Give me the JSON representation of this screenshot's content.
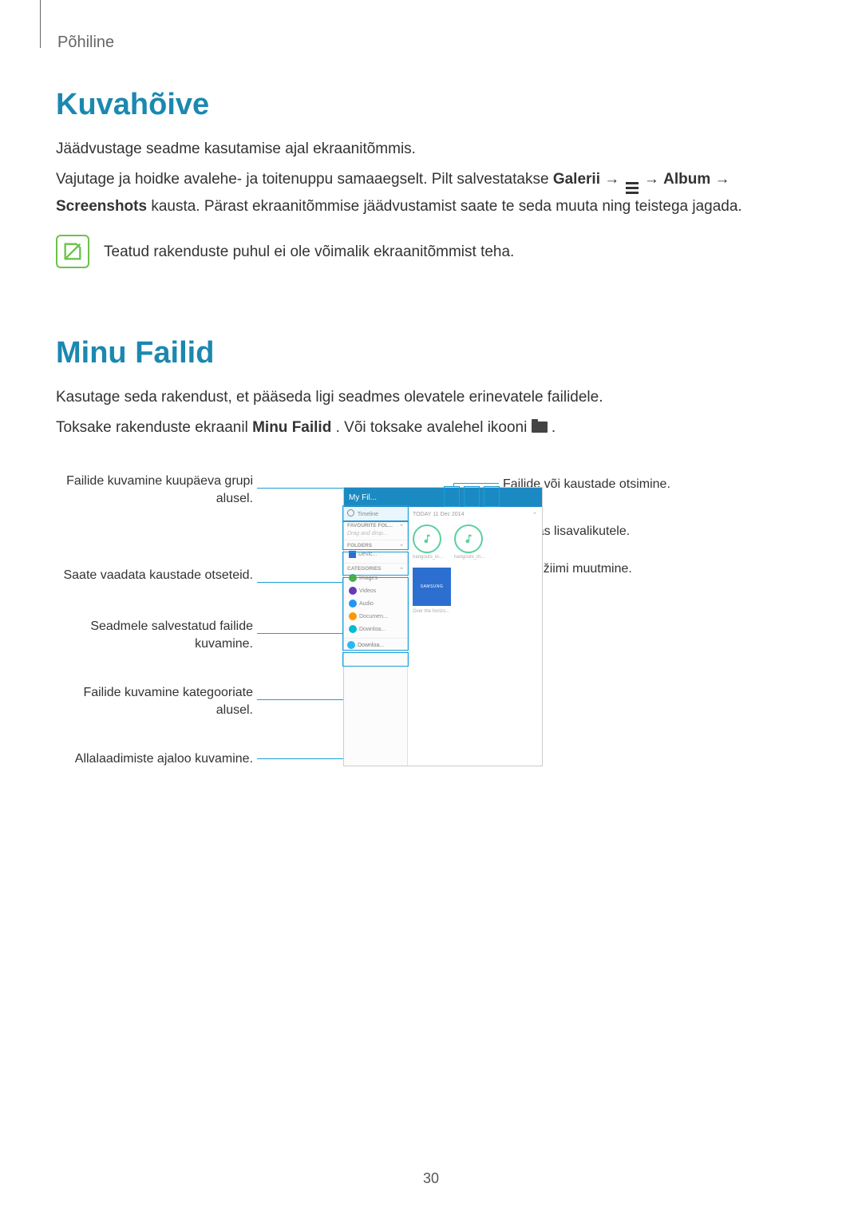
{
  "breadcrumb": "Põhiline",
  "section1": {
    "heading": "Kuvahõive",
    "p1": "Jäädvustage seadme kasutamise ajal ekraanitõmmis.",
    "p2a": "Vajutage ja hoidke avalehe- ja toitenuppu samaaegselt. Pilt salvestatakse ",
    "p2_gallery": "Galerii",
    "p2_arrow1": " → ",
    "p2_arrow2": " → ",
    "p2_album": "Album",
    "p3a": " → ",
    "p3_screenshots": "Screenshots",
    "p3b": " kausta. Pärast ekraanitõmmise jäädvustamist saate te seda muuta ning teistega jagada.",
    "note": "Teatud rakenduste puhul ei ole võimalik ekraanitõmmist teha."
  },
  "section2": {
    "heading": "Minu Failid",
    "p1": "Kasutage seda rakendust, et pääseda ligi seadmes olevatele erinevatele failidele.",
    "p2a": "Toksake rakenduste ekraanil ",
    "p2_app": "Minu Failid",
    "p2b": ". Või toksake avalehel ikooni ",
    "p2c": "."
  },
  "callouts": {
    "left1": "Failide kuvamine kuupäeva grupi alusel.",
    "left2": "Saate vaadata kaustade otseteid.",
    "left3": "Seadmele salvestatud failide kuvamine.",
    "left4": "Failide kuvamine kategooriate alusel.",
    "left5": "Allalaadimiste ajaloo kuvamine.",
    "right1": "Failide või kaustade otsimine.",
    "right2": "Ligipääs lisavalikutele.",
    "right3": "Kuvarežiimi muutmine."
  },
  "screenshot": {
    "title": "My Fil...",
    "date": "TODAY  11 Dec 2014",
    "sidebar": {
      "timeline": "Timeline",
      "favourite": "FAVOURITE FOL...",
      "draghint": "Drag and drop...",
      "folders": "FOLDERS",
      "device": "Devic...",
      "categories": "CATEGORIES",
      "images": "Images",
      "videos": "Videos",
      "audio": "Audio",
      "documents": "Documen...",
      "downloads1": "Downloa...",
      "downloads2": "Downloa..."
    },
    "thumbs": {
      "t1": "hangouts_inco...",
      "t2": "hangouts_mes..."
    },
    "samsung": "SAMSUNG",
    "caption": "Over the horizo..."
  },
  "page_number": "30"
}
